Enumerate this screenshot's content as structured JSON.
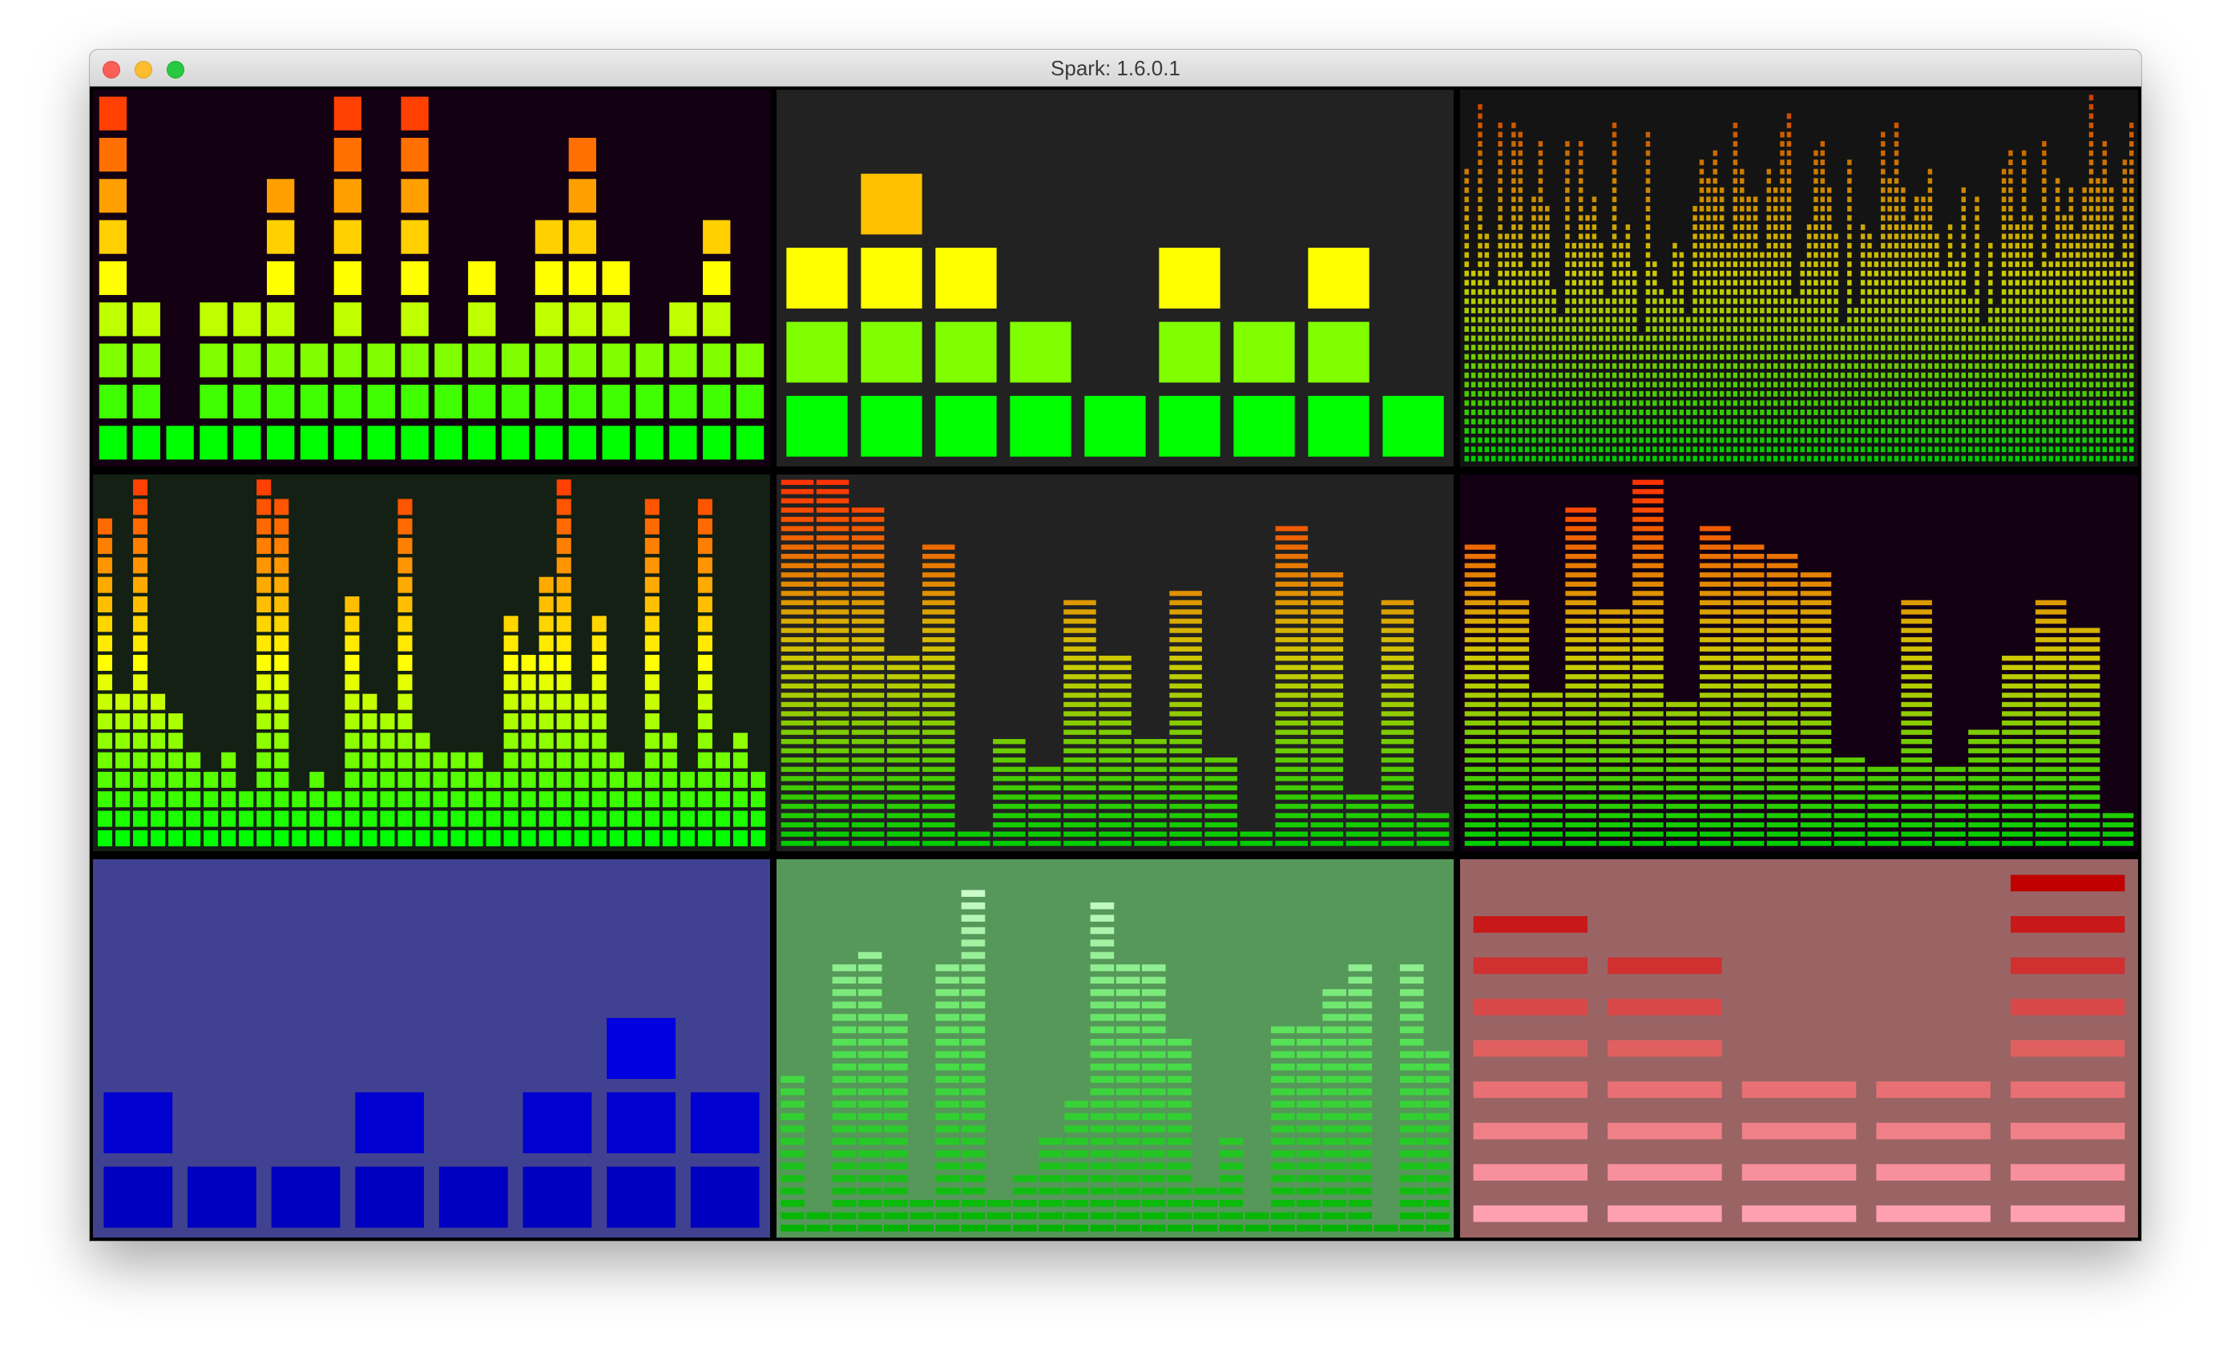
{
  "window": {
    "title": "Spark: 1.6.0.1",
    "controls": [
      "close-button",
      "minimize-button",
      "zoom-button"
    ]
  },
  "panels": [
    {
      "id": "panel-1",
      "background": "#130013",
      "segments": 9,
      "style": "blocks",
      "colors": [
        "#00ff00",
        "#ffff00",
        "#ff4000"
      ],
      "values": [
        9,
        4,
        1,
        4,
        4,
        7,
        3,
        9,
        3,
        9,
        3,
        5,
        3,
        6,
        8,
        5,
        3,
        4,
        6,
        3
      ]
    },
    {
      "id": "panel-2",
      "background": "#222222",
      "segments": 5,
      "style": "blocks",
      "colors": [
        "#00ff00",
        "#ffff00",
        "#ff8000"
      ],
      "values": [
        3,
        4,
        3,
        2,
        1,
        3,
        2,
        3,
        1
      ]
    },
    {
      "id": "panel-3",
      "background": "#141414",
      "segments": 40,
      "style": "dots",
      "colors": [
        "#00cc00",
        "#cccc00",
        "#cc4000"
      ],
      "values": [
        32,
        21,
        39,
        25,
        19,
        37,
        25,
        37,
        36,
        21,
        29,
        35,
        28,
        19,
        16,
        35,
        24,
        35,
        27,
        29,
        24,
        18,
        37,
        24,
        26,
        21,
        14,
        36,
        22,
        19,
        18,
        24,
        23,
        16,
        28,
        33,
        31,
        34,
        30,
        24,
        37,
        32,
        29,
        29,
        23,
        32,
        30,
        36,
        38,
        18,
        22,
        26,
        34,
        35,
        30,
        25,
        15,
        33,
        17,
        26,
        25,
        23,
        36,
        31,
        37,
        30,
        26,
        29,
        29,
        32,
        25,
        21,
        26,
        22,
        30,
        18,
        29,
        15,
        24,
        17,
        32,
        34,
        26,
        34,
        27,
        21,
        35,
        22,
        31,
        27,
        30,
        25,
        30,
        40,
        31,
        35,
        30,
        22,
        33,
        37
      ]
    },
    {
      "id": "panel-4",
      "background": "#132013",
      "segments": 19,
      "style": "blocks",
      "colors": [
        "#00ff00",
        "#ffff00",
        "#ff4000"
      ],
      "values": [
        17,
        8,
        19,
        8,
        7,
        5,
        4,
        5,
        3,
        19,
        18,
        3,
        4,
        3,
        13,
        8,
        7,
        18,
        6,
        5,
        5,
        5,
        4,
        12,
        10,
        14,
        19,
        8,
        12,
        5,
        4,
        18,
        6,
        4,
        18,
        5,
        6,
        4
      ]
    },
    {
      "id": "panel-5",
      "background": "#222222",
      "segments": 40,
      "style": "lines",
      "colors": [
        "#00cc00",
        "#cccc00",
        "#ff3300"
      ],
      "values": [
        40,
        40,
        37,
        21,
        33,
        2,
        12,
        9,
        27,
        21,
        12,
        28,
        10,
        2,
        35,
        30,
        6,
        27,
        4
      ]
    },
    {
      "id": "panel-6",
      "background": "#130013",
      "segments": 40,
      "style": "lines",
      "colors": [
        "#00cc00",
        "#cccc00",
        "#ff3300"
      ],
      "values": [
        33,
        27,
        17,
        37,
        26,
        40,
        16,
        35,
        33,
        32,
        30,
        10,
        9,
        27,
        9,
        13,
        21,
        27,
        24,
        4
      ]
    },
    {
      "id": "panel-7",
      "background": "#414191",
      "segments": 5,
      "style": "blocks",
      "colors": [
        "#0000c0",
        "#0000e0",
        "#5050ff"
      ],
      "values": [
        2,
        1,
        1,
        2,
        1,
        2,
        3,
        2
      ]
    },
    {
      "id": "panel-8",
      "background": "#56985a",
      "segments": 30,
      "style": "lines",
      "colors": [
        "#00b400",
        "#50e050",
        "#dcffdc"
      ],
      "values": [
        13,
        2,
        22,
        23,
        18,
        3,
        22,
        28,
        3,
        5,
        8,
        11,
        27,
        22,
        22,
        16,
        4,
        8,
        2,
        17,
        17,
        20,
        22,
        1,
        22,
        15
      ]
    },
    {
      "id": "panel-9",
      "background": "#9a6464",
      "segments": 9,
      "style": "bars",
      "colors": [
        "#ffa0b0",
        "#e06060",
        "#c00000"
      ],
      "values": [
        8,
        7,
        4,
        4,
        9
      ]
    }
  ]
}
